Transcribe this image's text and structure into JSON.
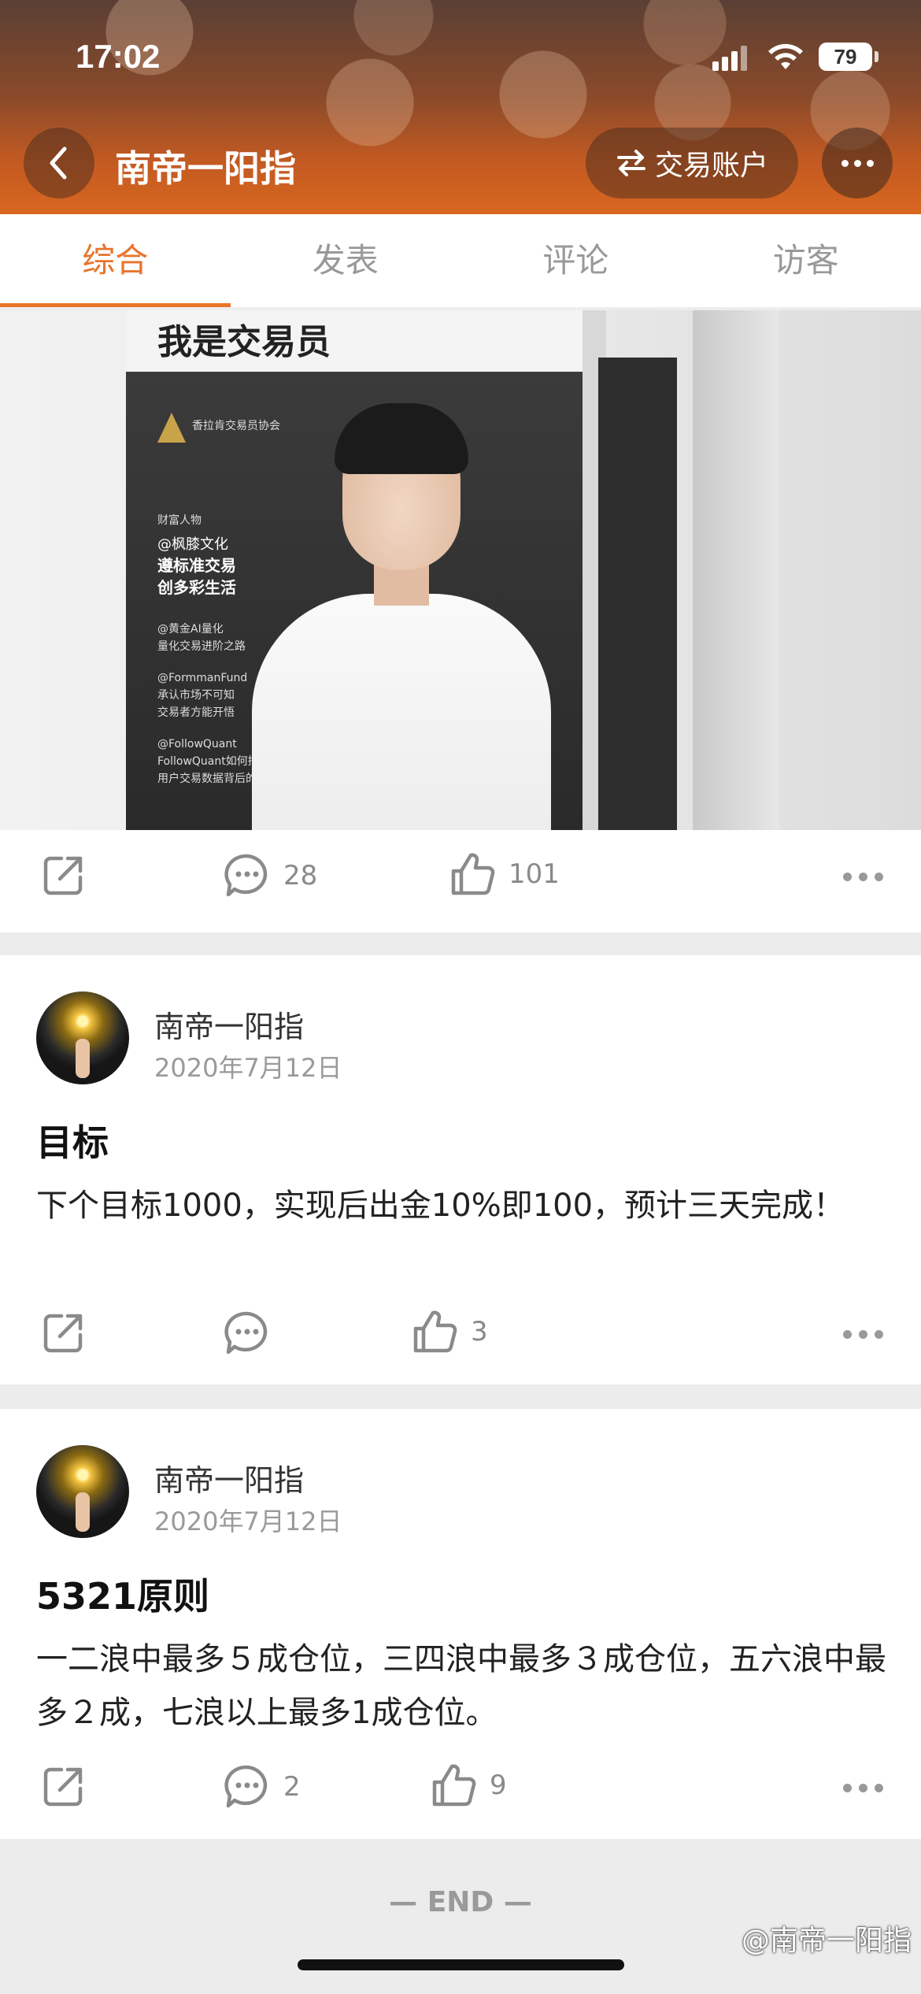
{
  "status_bar": {
    "time": "17:02",
    "battery": "79"
  },
  "header": {
    "title": "南帝一阳指",
    "trade_label": "交易账户"
  },
  "tabs": [
    {
      "label": "综合",
      "active": true
    },
    {
      "label": "发表",
      "active": false
    },
    {
      "label": "评论",
      "active": false
    },
    {
      "label": "访客",
      "active": false
    }
  ],
  "feed": {
    "image_post": {
      "image": {
        "magazine_title": "我是交易员",
        "org": "香拉肯交易员协会",
        "lines": [
          "财富人物",
          "@枫膝文化",
          "遵标准交易",
          "创多彩生活",
          "@黄金AI量化",
          "量化交易进阶之路",
          "@FormmanFund",
          "承认市场不可知",
          "交易者方能开悟",
          "@FollowQuant",
          "FollowQuant如何挖掘",
          "用户交易数据背后的价值"
        ]
      },
      "comments": "28",
      "likes": "101"
    },
    "posts": [
      {
        "author": "南帝一阳指",
        "date": "2020年7月12日",
        "title": "目标",
        "body": "下个目标1000，实现后出金10%即100，预计三天完成！",
        "comments": "",
        "likes": "3"
      },
      {
        "author": "南帝一阳指",
        "date": "2020年7月12日",
        "title": "5321原则",
        "body": "一二浪中最多５成仓位，三四浪中最多３成仓位，五六浪中最多２成，七浪以上最多1成仓位。",
        "comments": "2",
        "likes": "9"
      }
    ]
  },
  "end_label": "— END —",
  "watermark": "@南帝一阳指",
  "colors": {
    "accent": "#e8742c",
    "header": "#c25a22"
  }
}
